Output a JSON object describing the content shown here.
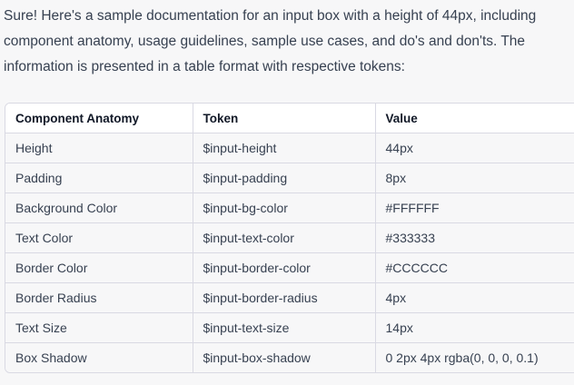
{
  "intro": {
    "line1": "Sure! Here's a sample documentation for an input box with a height of 44px, including",
    "line2": "component anatomy, usage guidelines, sample use cases, and do's and don'ts. The",
    "line3": "information is presented in a table format with respective tokens:"
  },
  "table": {
    "headers": [
      "Component Anatomy",
      "Token",
      "Value"
    ],
    "rows": [
      [
        "Height",
        "$input-height",
        "44px"
      ],
      [
        "Padding",
        "$input-padding",
        "8px"
      ],
      [
        "Background Color",
        "$input-bg-color",
        "#FFFFFF"
      ],
      [
        "Text Color",
        "$input-text-color",
        "#333333"
      ],
      [
        "Border Color",
        "$input-border-color",
        "#CCCCCC"
      ],
      [
        "Border Radius",
        "$input-border-radius",
        "4px"
      ],
      [
        "Text Size",
        "$input-text-size",
        "14px"
      ],
      [
        "Box Shadow",
        "$input-box-shadow",
        "0 2px 4px rgba(0, 0, 0, 0.1)"
      ]
    ]
  }
}
